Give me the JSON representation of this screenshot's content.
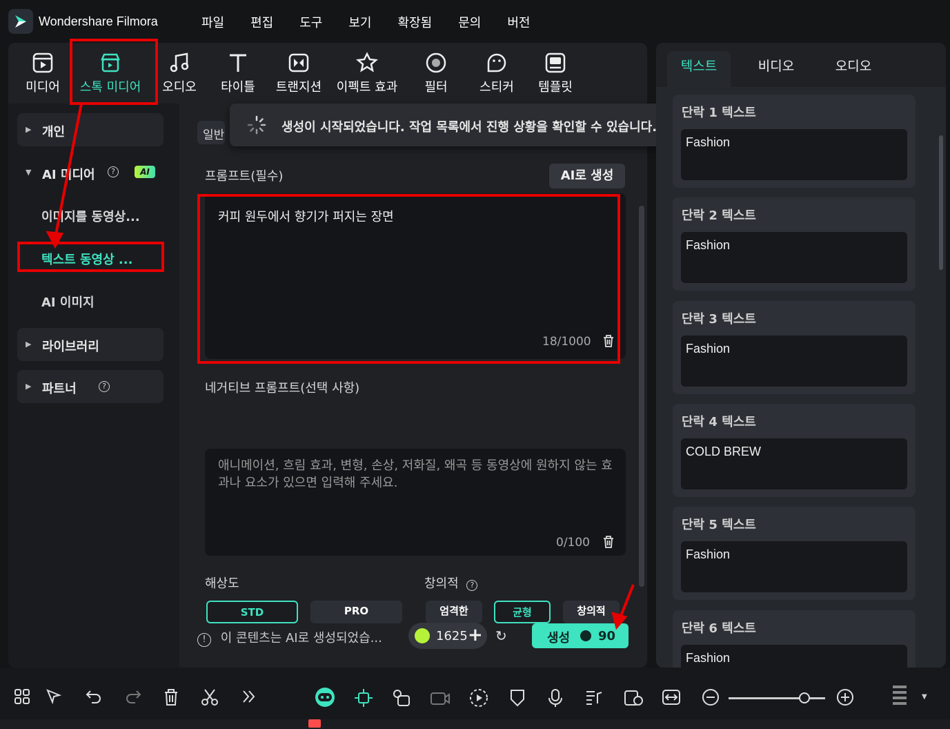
{
  "app": {
    "title": "Wondershare Filmora"
  },
  "menu": [
    "파일",
    "편집",
    "도구",
    "보기",
    "확장됨",
    "문의",
    "버전"
  ],
  "toolbar": {
    "tabs": [
      {
        "label": "미디어",
        "icon": "media-icon"
      },
      {
        "label": "스톡 미디어",
        "icon": "stock-media-icon",
        "active": true
      },
      {
        "label": "오디오",
        "icon": "music-note-icon"
      },
      {
        "label": "타이틀",
        "icon": "title-t-icon"
      },
      {
        "label": "트랜지션",
        "icon": "transition-icon"
      },
      {
        "label": "이펙트 효과",
        "icon": "effects-icon"
      },
      {
        "label": "필터",
        "icon": "filter-icon"
      },
      {
        "label": "스티커",
        "icon": "sticker-icon"
      },
      {
        "label": "템플릿",
        "icon": "template-icon"
      }
    ]
  },
  "sidebar": {
    "personal": "개인",
    "ai_media": "AI 미디어",
    "ai_badge": "AI",
    "image_to_video": "이미지를 동영상...",
    "text_to_video": "텍스트 동영상 ...",
    "ai_image": "AI 이미지",
    "library": "라이브러리",
    "partner": "파트너",
    "help_mark": "?"
  },
  "content": {
    "general_tab": "일반",
    "toast": "생성이 시작되었습니다. 작업 목록에서 진행 상황을 확인할 수 있습니다.",
    "prompt_label": "프롬프트(필수)",
    "ai_generate": "AI로 생성",
    "prompt_value": "커피 원두에서 향기가 퍼지는 장면",
    "prompt_counter": "18/1000",
    "negative_label": "네거티브 프롬프트(선택 사항)",
    "negative_placeholder": "애니메이션, 흐림 효과, 변형, 손상, 저화질, 왜곡 등 동영상에 원하지 않는 효과나 요소가 있으면 입력해 주세요.",
    "negative_counter": "0/100",
    "resolution_label": "해상도",
    "resolution_options": [
      "STD",
      "PRO"
    ],
    "resolution_selected": "STD",
    "creativity_label": "창의적",
    "creativity_options": [
      "엄격한",
      "균형",
      "창의적"
    ],
    "creativity_selected": "균형",
    "notice": "이 콘텐츠는 AI로 생성되었습...",
    "credits": "1625",
    "generate_label": "생성",
    "generate_cost": "90"
  },
  "right": {
    "tabs": [
      "텍스트",
      "비디오",
      "오디오"
    ],
    "active_tab": "텍스트",
    "paragraphs": [
      {
        "title": "단락 1 텍스트",
        "value": "Fashion"
      },
      {
        "title": "단락 2 텍스트",
        "value": "Fashion"
      },
      {
        "title": "단락 3 텍스트",
        "value": "Fashion"
      },
      {
        "title": "단락 4 텍스트",
        "value": "COLD BREW"
      },
      {
        "title": "단락 5 텍스트",
        "value": "Fashion"
      },
      {
        "title": "단락 6 텍스트",
        "value": "Fashion"
      }
    ]
  },
  "colors": {
    "accent": "#3ee3c0",
    "annotation": "#e60000",
    "panel": "#1f2125"
  }
}
